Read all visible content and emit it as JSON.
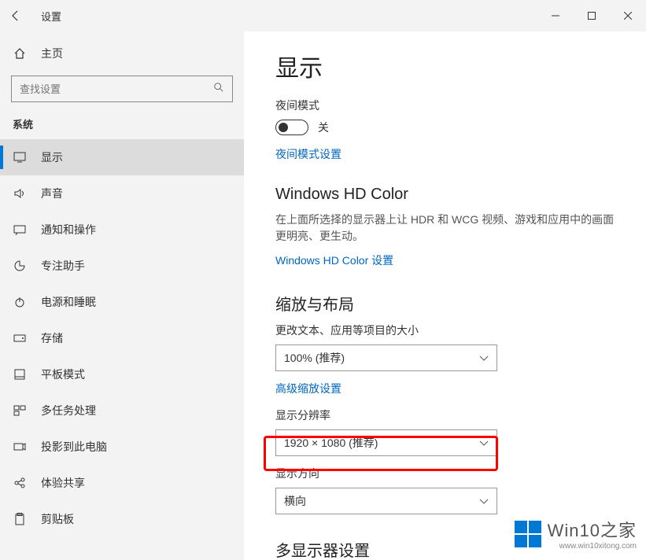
{
  "titlebar": {
    "title": "设置"
  },
  "sidebar": {
    "home": "主页",
    "search_placeholder": "查找设置",
    "category": "系统",
    "items": [
      {
        "label": "显示"
      },
      {
        "label": "声音"
      },
      {
        "label": "通知和操作"
      },
      {
        "label": "专注助手"
      },
      {
        "label": "电源和睡眠"
      },
      {
        "label": "存储"
      },
      {
        "label": "平板模式"
      },
      {
        "label": "多任务处理"
      },
      {
        "label": "投影到此电脑"
      },
      {
        "label": "体验共享"
      },
      {
        "label": "剪贴板"
      }
    ]
  },
  "main": {
    "heading": "显示",
    "night_mode_label": "夜间模式",
    "toggle_state": "关",
    "night_mode_link": "夜间模式设置",
    "hdcolor_heading": "Windows HD Color",
    "hdcolor_desc": "在上面所选择的显示器上让 HDR 和 WCG 视频、游戏和应用中的画面更明亮、更生动。",
    "hdcolor_link": "Windows HD Color 设置",
    "scale_heading": "缩放与布局",
    "scale_label": "更改文本、应用等项目的大小",
    "scale_value": "100% (推荐)",
    "adv_scale_link": "高级缩放设置",
    "resolution_label": "显示分辨率",
    "resolution_value": "1920 × 1080 (推荐)",
    "orientation_label": "显示方向",
    "orientation_value": "横向",
    "multi_heading": "多显示器设置"
  },
  "watermark": {
    "brand": "Win10之家",
    "url": "www.win10xitong.com"
  }
}
